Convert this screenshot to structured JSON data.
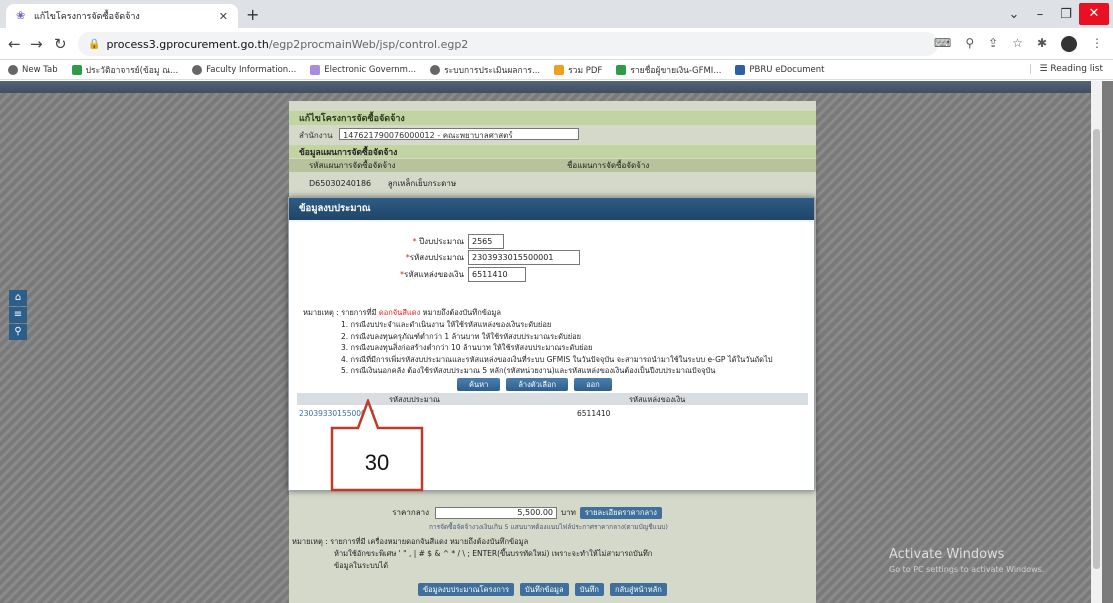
{
  "browser": {
    "tab_title": "แก้ไขโครงการจัดซื้อจัดจ้าง",
    "url_host": "process3.gprocurement.go.th",
    "url_path": "/egp2procmainWeb/jsp/control.egp2",
    "bookmarks": [
      "New Tab",
      "ประวัติอาจารย์(ข้อมู ณ...",
      "Faculty Information...",
      "Electronic Governm...",
      "ระบบการประเมินผลการ...",
      "รวม PDF",
      "รายชื่อผู้ขายเงิน-GFMI...",
      "PBRU eDocument"
    ],
    "reading_list": "Reading list"
  },
  "form": {
    "title": "แก้ไขโครงการจัดซื้อจัดจ้าง",
    "office_label": "สำนักงาน",
    "office_value": "147621790076000012 - คณะพยาบาลศาสตร์",
    "plan_section": "ข้อมูลแผนการจัดซื้อจัดจ้าง",
    "plan_code_header": "รหัสแผนการจัดซื้อจัดจ้าง",
    "plan_name_header": "ชื่อแผนการจัดซื้อจัดจ้าง",
    "plan_code": "D65030240186",
    "plan_name": "ลูกเหล็กเย็บกระดาษ",
    "price_label": "ราคากลาง",
    "price_value": "5,500.00",
    "price_unit": "บาท",
    "price_detail_btn": "รายละเอียดราคากลาง",
    "price_note": "การจัดซื้อจัดจ้างวงเงินเกิน 5 แสนบาทต้องแนบไฟล์ประกาศราคากลาง(ตามบัญชีแนบ)",
    "note_line1": "หมายเหตุ : รายการที่มี เครื่องหมายดอกจันสีแดง หมายถึงต้องบันทึกข้อมูล",
    "note_line2": "ห้ามใช้อักขระพิเศษ ' \" , | # $ & ^ * / \\ ; ENTER(ขึ้นบรรทัดใหม่) เพราะจะทำให้ไม่สามารถบันทึก",
    "note_line3": "ข้อมูลในระบบได้",
    "btn_budget": "ข้อมูลงบประมาณโครงการ",
    "btn_save_project": "บันทึกข้อมูล",
    "btn_save": "บันทึก",
    "btn_back": "กลับสู่หน้าหลัก"
  },
  "modal": {
    "title": "ข้อมูลงบประมาณ",
    "fiscal_year_label": "ปีงบประมาณ",
    "fiscal_year_value": "2565",
    "budget_code_label": "รหัสงบประมาณ",
    "budget_code_value": "2303933015500001",
    "source_label": "รหัสแหล่งของเงิน",
    "source_value": "6511410",
    "remark_prefix": "หมายเหตุ : รายการที่มี",
    "remark_red": "ดอกจันสีแดง",
    "remark_suffix": "หมายถึงต้องบันทึกข้อมูล",
    "remark_items": [
      "1. กรณีงบประจำและดำเนินงาน ให้ใช้รหัสแหล่งของเงินระดับย่อย",
      "2. กรณีงบลงทุนครุภัณฑ์ต่ำกว่า 1 ล้านบาท ให้ใช้รหัสงบประมาณระดับย่อย",
      "3. กรณีงบลงทุนสิ่งก่อสร้างต่ำกว่า 10 ล้านบาท ให้ใช้รหัสงบประมาณระดับย่อย",
      "4. กรณีที่มีการเพิ่มรหัสงบประมาณและรหัสแหล่งของเงินที่ระบบ GFMIS ในวันปัจจุบัน จะสามารถนำมาใช้ในระบบ e-GP ได้ในวันถัดไป",
      "5. กรณีเงินนอกคลัง ต้องใช้รหัสงบประมาณ 5 หลัก(รหัสหน่วยงาน)และรหัสแหล่งของเงินต้องเป็นปีงบประมาณปัจจุบัน"
    ],
    "btn_search": "ค้นหา",
    "btn_clear": "ล้างตัวเลือก",
    "btn_exit": "ออก",
    "col_budget_code": "รหัสงบประมาณ",
    "col_source": "รหัสแหล่งของเงิน",
    "rows": [
      {
        "budget_code": "2303933015500001",
        "source": "6511410"
      }
    ]
  },
  "callout": {
    "label": "30",
    "color": "#c0392b"
  },
  "watermark": {
    "line1": "Activate Windows",
    "line2": "Go to PC settings to activate Windows."
  }
}
